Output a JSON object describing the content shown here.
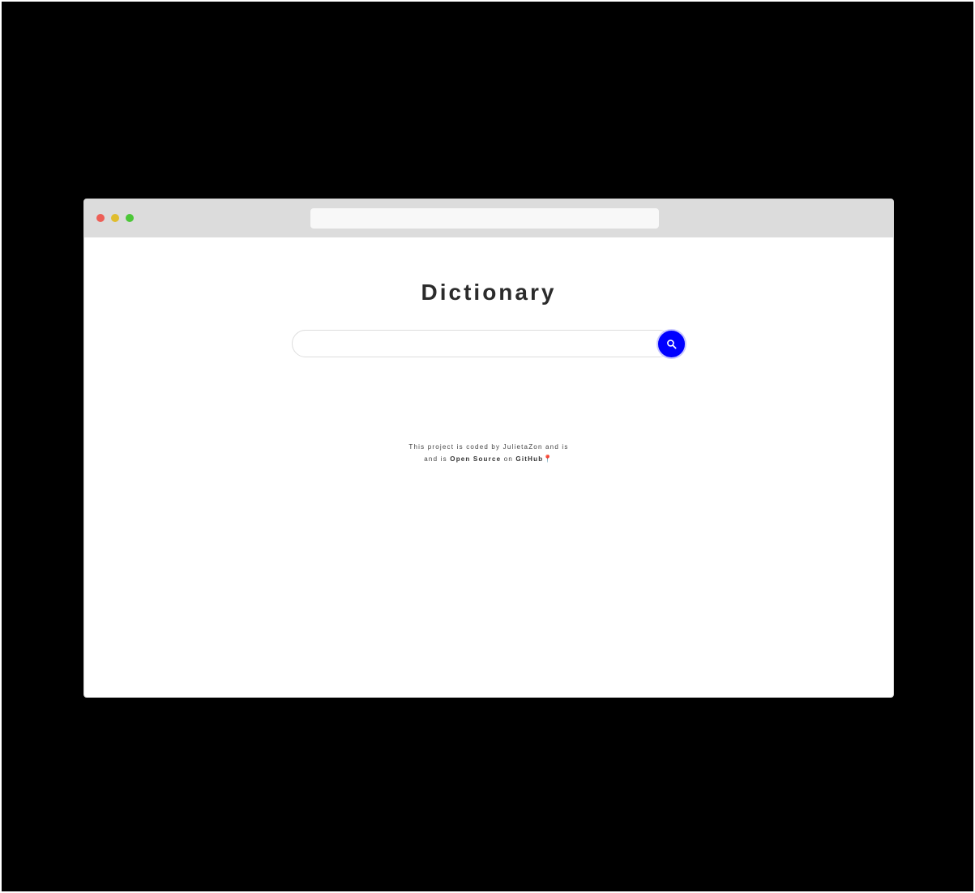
{
  "colors": {
    "frame_background": "#000000",
    "browser_bar": "#dcdcdc",
    "address_bar": "#f8f8f8",
    "traffic_red": "#ed5f57",
    "traffic_yellow": "#e0bd2e",
    "traffic_green": "#4cc738",
    "accent": "#0000ff",
    "title_text": "#2b2b2b"
  },
  "browser": {
    "address_value": "",
    "window_controls": [
      "close-dot",
      "minimize-dot",
      "maximize-dot"
    ]
  },
  "page": {
    "title": "Dictionary",
    "search": {
      "value": "",
      "placeholder": "",
      "button_icon": "search-icon"
    },
    "footer": {
      "line1": "This project is coded by JulietaZon and is",
      "line2_prefix": "and is ",
      "open_source_link": "Open Source",
      "line2_middle": " on ",
      "github_link": "GitHub",
      "pin_icon": "📍"
    }
  }
}
